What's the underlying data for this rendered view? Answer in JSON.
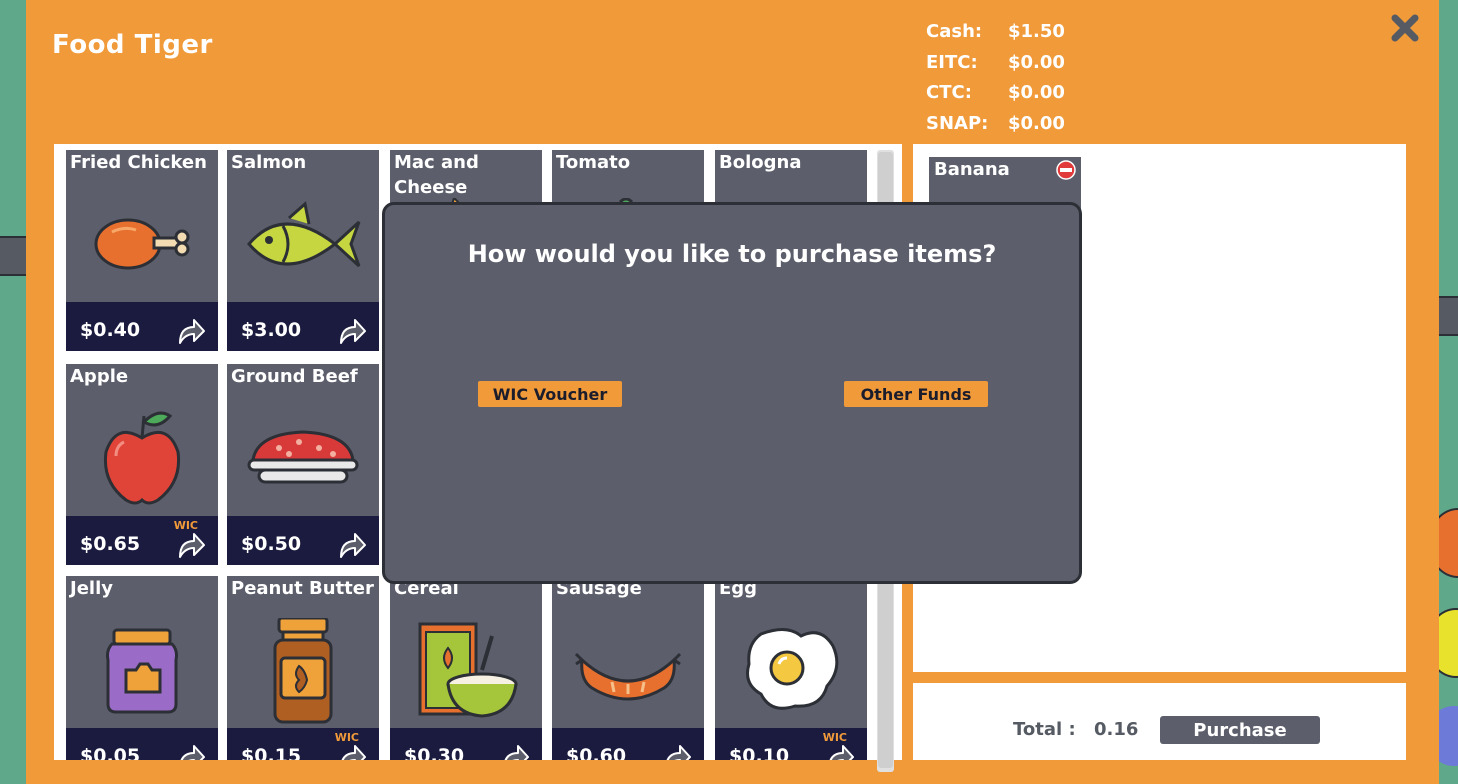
{
  "store": {
    "title": "Food Tiger"
  },
  "balances": [
    {
      "label": "Cash:",
      "value": "$1.50"
    },
    {
      "label": "EITC:",
      "value": "$0.00"
    },
    {
      "label": "CTC:",
      "value": "$0.00"
    },
    {
      "label": "SNAP:",
      "value": "$0.00"
    }
  ],
  "items": [
    {
      "name": "Fried Chicken",
      "price": "$0.40",
      "wic": "",
      "icon": "fried-chicken-icon"
    },
    {
      "name": "Salmon",
      "price": "$3.00",
      "wic": "",
      "icon": "salmon-icon"
    },
    {
      "name": "Mac and Cheese",
      "price": "",
      "wic": "",
      "icon": "mac-and-cheese-icon"
    },
    {
      "name": "Tomato",
      "price": "",
      "wic": "",
      "icon": "tomato-icon"
    },
    {
      "name": "Bologna",
      "price": "",
      "wic": "",
      "icon": "bologna-icon"
    },
    {
      "name": "Apple",
      "price": "$0.65",
      "wic": "WIC",
      "icon": "apple-icon"
    },
    {
      "name": "Ground Beef",
      "price": "$0.50",
      "wic": "",
      "icon": "ground-beef-icon"
    },
    {
      "name": "Jelly",
      "price": "$0.05",
      "wic": "",
      "icon": "jelly-icon"
    },
    {
      "name": "Peanut Butter",
      "price": "$0.15",
      "wic": "WIC",
      "icon": "peanut-butter-icon"
    },
    {
      "name": "Cereal",
      "price": "$0.30",
      "wic": "",
      "icon": "cereal-icon"
    },
    {
      "name": "Sausage",
      "price": "$0.60",
      "wic": "",
      "icon": "sausage-icon"
    },
    {
      "name": "Egg",
      "price": "$0.10",
      "wic": "WIC",
      "icon": "egg-icon"
    }
  ],
  "cart": {
    "items": [
      {
        "name": "Banana"
      }
    ],
    "total_label": "Total :",
    "total_value": "0.16",
    "purchase_label": "Purchase"
  },
  "modal": {
    "title": "How would you like to purchase items?",
    "wic_label": "WIC Voucher",
    "other_label": "Other Funds"
  },
  "colors": {
    "panel": "#f09a3a",
    "card": "#5c5f6b",
    "price_bar": "#1a1b3f",
    "wic": "#f09a3a"
  }
}
